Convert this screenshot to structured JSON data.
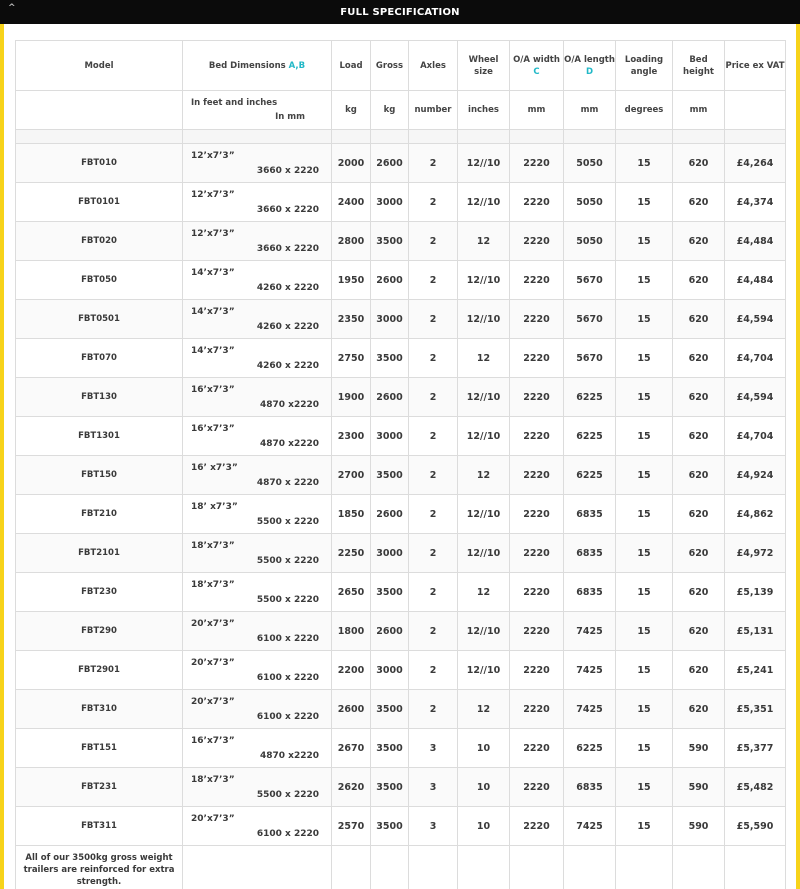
{
  "header": {
    "title": "FULL SPECIFICATION",
    "caret": "^"
  },
  "table": {
    "columns": [
      {
        "label": "Model"
      },
      {
        "label": "Bed Dimensions ",
        "suffix": "A,B"
      },
      {
        "label": "Load"
      },
      {
        "label": "Gross"
      },
      {
        "label": "Axles"
      },
      {
        "label": "Wheel size"
      },
      {
        "label": "O/A width ",
        "suffix": "C"
      },
      {
        "label": "O/A length ",
        "suffix": "D"
      },
      {
        "label": "Loading angle"
      },
      {
        "label": "Bed height"
      },
      {
        "label": "Price ex VAT"
      }
    ],
    "units": {
      "model": "",
      "dims_ft": "In feet and inches",
      "dims_mm": "In mm",
      "load": "kg",
      "gross": "kg",
      "axles": "number",
      "wheel": "inches",
      "width": "mm",
      "length": "mm",
      "angle": "degrees",
      "height": "mm",
      "price": ""
    },
    "rows": [
      {
        "model": "FBT010",
        "ft": "12’x7’3”",
        "mm": "3660 x 2220",
        "load": "2000",
        "gross": "2600",
        "axles": "2",
        "wheel": "12//10",
        "width": "2220",
        "length": "5050",
        "angle": "15",
        "height": "620",
        "price": "£4,264"
      },
      {
        "model": "FBT0101",
        "ft": "12’x7’3”",
        "mm": "3660 x 2220",
        "load": "2400",
        "gross": "3000",
        "axles": "2",
        "wheel": "12//10",
        "width": "2220",
        "length": "5050",
        "angle": "15",
        "height": "620",
        "price": "£4,374"
      },
      {
        "model": "FBT020",
        "ft": "12’x7’3”",
        "mm": "3660 x 2220",
        "load": "2800",
        "gross": "3500",
        "axles": "2",
        "wheel": "12",
        "width": "2220",
        "length": "5050",
        "angle": "15",
        "height": "620",
        "price": "£4,484"
      },
      {
        "model": "FBT050",
        "ft": "14’x7’3”",
        "mm": "4260 x 2220",
        "load": "1950",
        "gross": "2600",
        "axles": "2",
        "wheel": "12//10",
        "width": "2220",
        "length": "5670",
        "angle": "15",
        "height": "620",
        "price": "£4,484"
      },
      {
        "model": "FBT0501",
        "ft": "14’x7’3”",
        "mm": "4260 x 2220",
        "load": "2350",
        "gross": "3000",
        "axles": "2",
        "wheel": "12//10",
        "width": "2220",
        "length": "5670",
        "angle": "15",
        "height": "620",
        "price": "£4,594"
      },
      {
        "model": "FBT070",
        "ft": "14’x7’3”",
        "mm": "4260 x 2220",
        "load": "2750",
        "gross": "3500",
        "axles": "2",
        "wheel": "12",
        "width": "2220",
        "length": "5670",
        "angle": "15",
        "height": "620",
        "price": "£4,704"
      },
      {
        "model": "FBT130",
        "ft": "16’x7’3”",
        "mm": "4870 x2220",
        "load": "1900",
        "gross": "2600",
        "axles": "2",
        "wheel": "12//10",
        "width": "2220",
        "length": "6225",
        "angle": "15",
        "height": "620",
        "price": "£4,594"
      },
      {
        "model": "FBT1301",
        "ft": "16’x7’3”",
        "mm": "4870 x2220",
        "load": "2300",
        "gross": "3000",
        "axles": "2",
        "wheel": "12//10",
        "width": "2220",
        "length": "6225",
        "angle": "15",
        "height": "620",
        "price": "£4,704"
      },
      {
        "model": "FBT150",
        "ft": "16’ x7’3”",
        "mm": "4870 x 2220",
        "load": "2700",
        "gross": "3500",
        "axles": "2",
        "wheel": "12",
        "width": "2220",
        "length": "6225",
        "angle": "15",
        "height": "620",
        "price": "£4,924"
      },
      {
        "model": "FBT210",
        "ft": "18’ x7’3”",
        "mm": "5500 x 2220",
        "load": "1850",
        "gross": "2600",
        "axles": "2",
        "wheel": "12//10",
        "width": "2220",
        "length": "6835",
        "angle": "15",
        "height": "620",
        "price": "£4,862"
      },
      {
        "model": "FBT2101",
        "ft": "18’x7’3”",
        "mm": "5500 x 2220",
        "load": "2250",
        "gross": "3000",
        "axles": "2",
        "wheel": "12//10",
        "width": "2220",
        "length": "6835",
        "angle": "15",
        "height": "620",
        "price": "£4,972"
      },
      {
        "model": "FBT230",
        "ft": "18’x7’3”",
        "mm": "5500 x 2220",
        "load": "2650",
        "gross": "3500",
        "axles": "2",
        "wheel": "12",
        "width": "2220",
        "length": "6835",
        "angle": "15",
        "height": "620",
        "price": "£5,139"
      },
      {
        "model": "FBT290",
        "ft": "20’x7’3”",
        "mm": "6100 x 2220",
        "load": "1800",
        "gross": "2600",
        "axles": "2",
        "wheel": "12//10",
        "width": "2220",
        "length": "7425",
        "angle": "15",
        "height": "620",
        "price": "£5,131"
      },
      {
        "model": "FBT2901",
        "ft": "20’x7’3”",
        "mm": "6100 x 2220",
        "load": "2200",
        "gross": "3000",
        "axles": "2",
        "wheel": "12//10",
        "width": "2220",
        "length": "7425",
        "angle": "15",
        "height": "620",
        "price": "£5,241"
      },
      {
        "model": "FBT310",
        "ft": "20’x7’3”",
        "mm": "6100 x 2220",
        "load": "2600",
        "gross": "3500",
        "axles": "2",
        "wheel": "12",
        "width": "2220",
        "length": "7425",
        "angle": "15",
        "height": "620",
        "price": "£5,351"
      },
      {
        "model": "FBT151",
        "ft": "16’x7’3”",
        "mm": "4870 x2220",
        "load": "2670",
        "gross": "3500",
        "axles": "3",
        "wheel": "10",
        "width": "2220",
        "length": "6225",
        "angle": "15",
        "height": "590",
        "price": "£5,377"
      },
      {
        "model": "FBT231",
        "ft": "18’x7’3”",
        "mm": "5500 x 2220",
        "load": "2620",
        "gross": "3500",
        "axles": "3",
        "wheel": "10",
        "width": "2220",
        "length": "6835",
        "angle": "15",
        "height": "590",
        "price": "£5,482"
      },
      {
        "model": "FBT311",
        "ft": "20’x7’3”",
        "mm": "6100 x 2220",
        "load": "2570",
        "gross": "3500",
        "axles": "3",
        "wheel": "10",
        "width": "2220",
        "length": "7425",
        "angle": "15",
        "height": "590",
        "price": "£5,590"
      }
    ],
    "footnote": "All of our 3500kg gross weight trailers are reinforced for extra strength."
  },
  "colors": {
    "accent": "#f7d31a",
    "header_bg": "#0b0b0b",
    "highlight": "#21b8c7"
  }
}
